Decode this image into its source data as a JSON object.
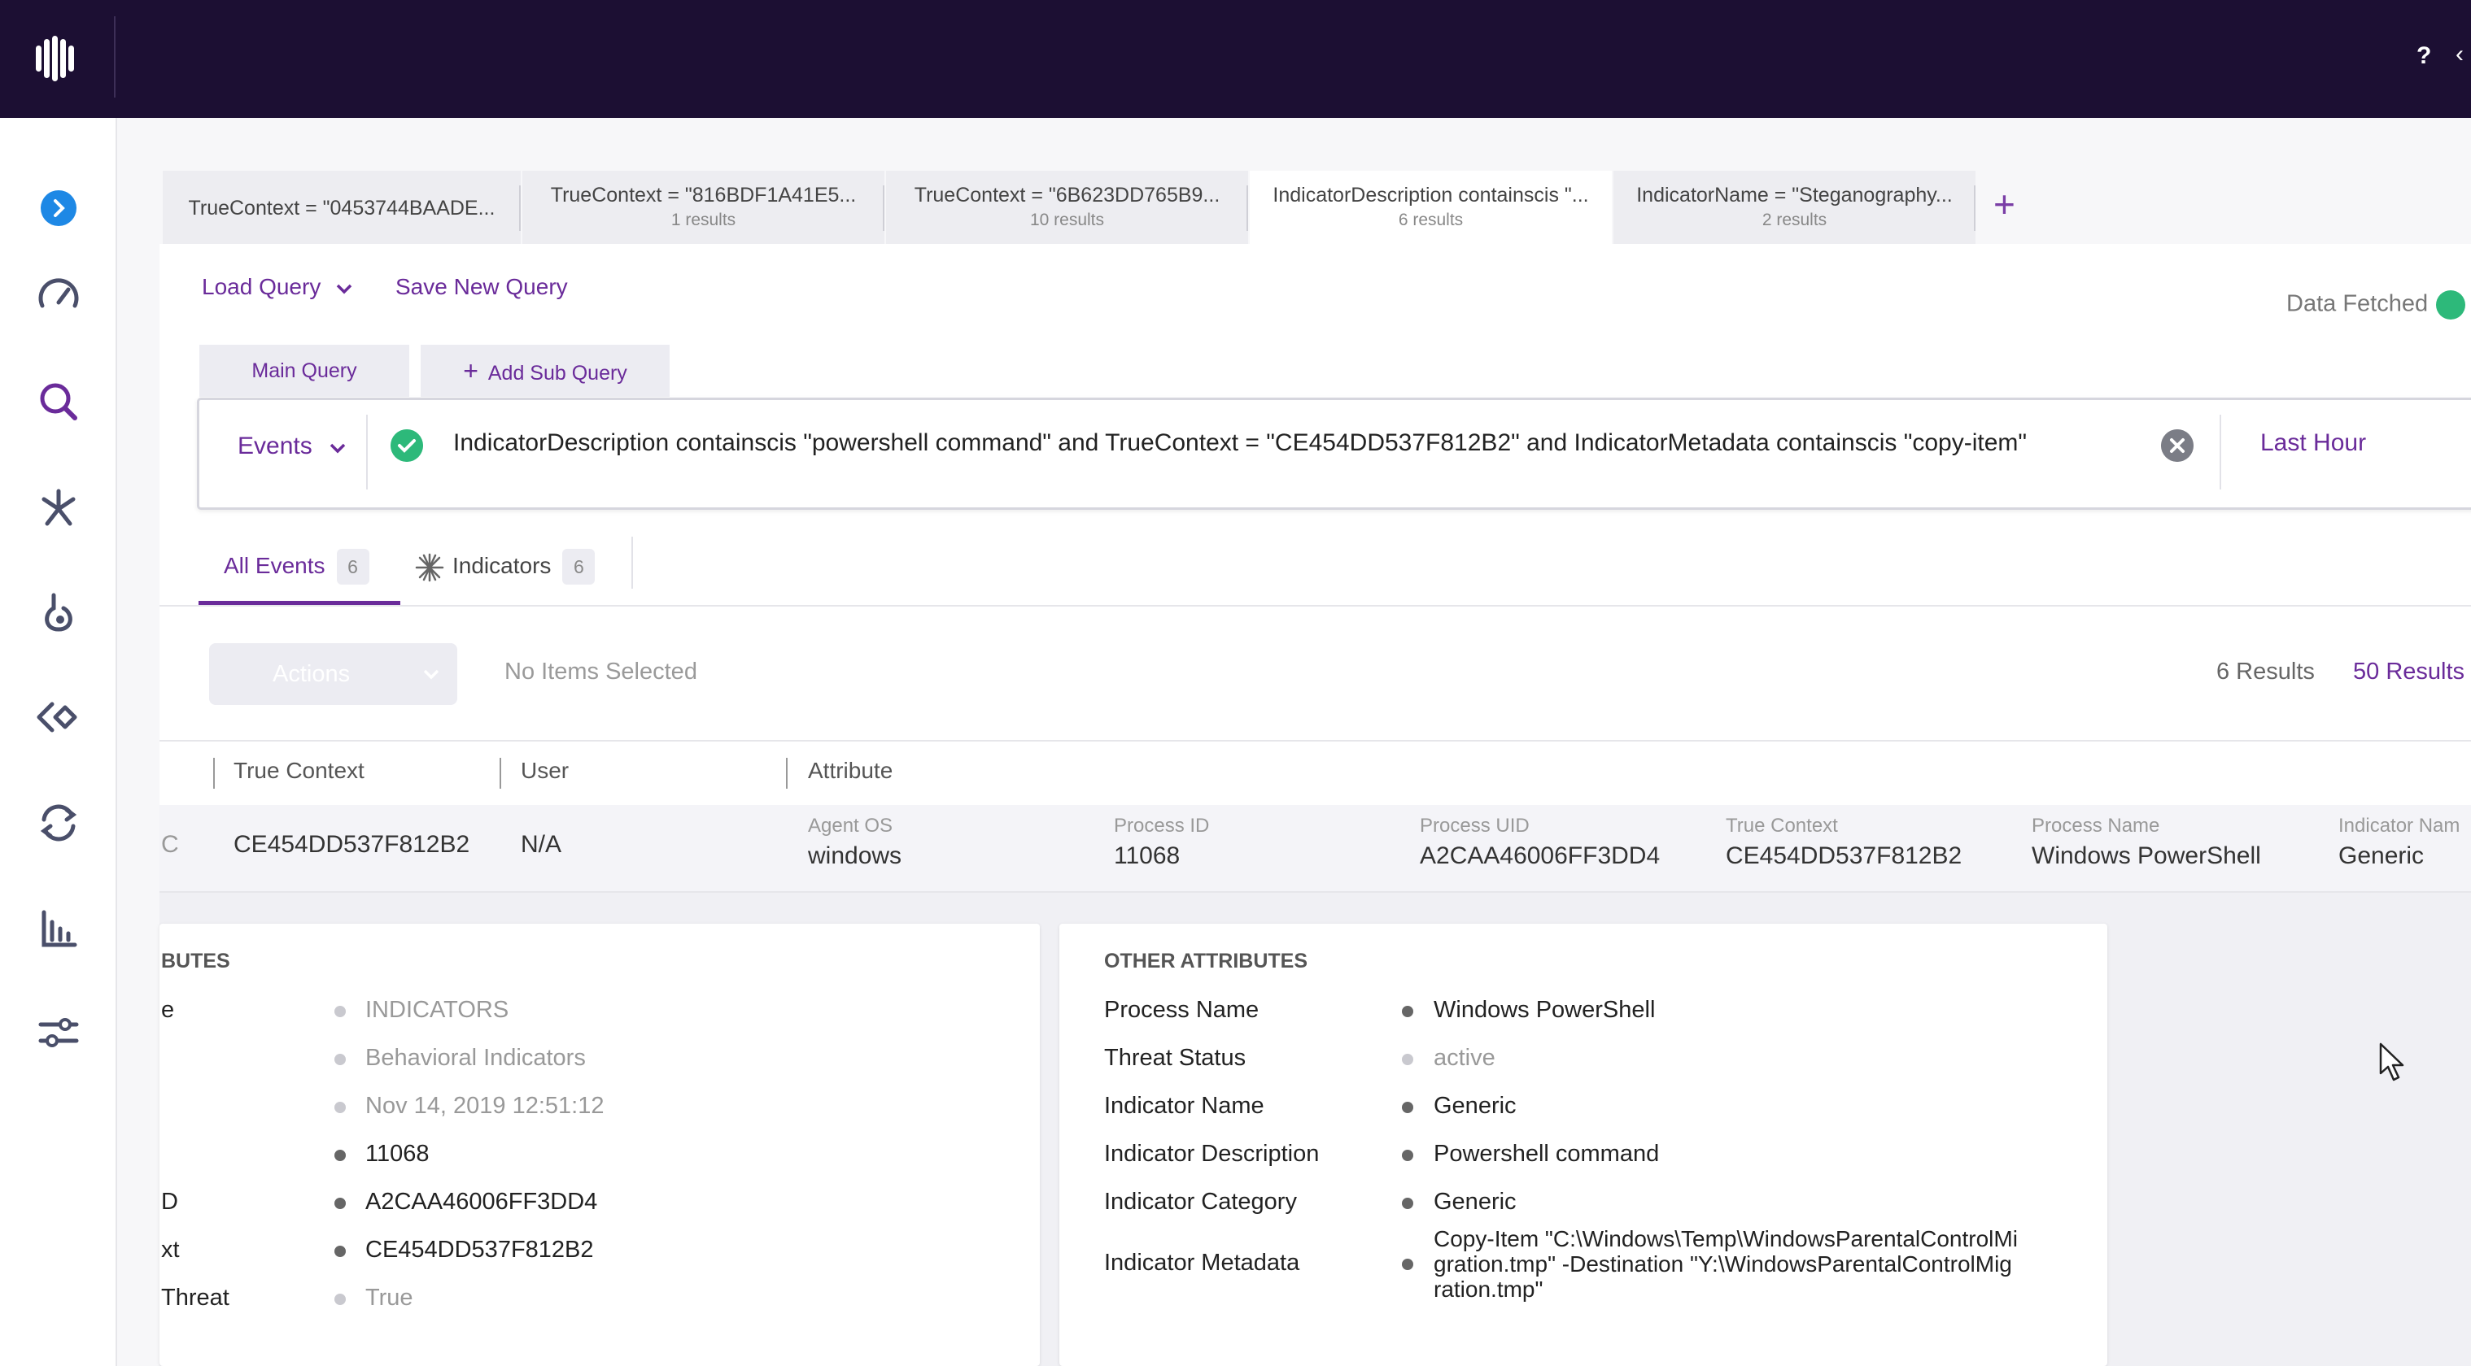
{
  "topbar": {
    "help": "?",
    "chevron": "‹"
  },
  "rail": {
    "icons": [
      "expand-icon",
      "dashboard-icon",
      "search-icon",
      "asterisk-icon",
      "flask-icon",
      "diamond-icon",
      "sync-icon",
      "bar-chart-icon",
      "sliders-icon"
    ]
  },
  "query_tabs": [
    {
      "title": "TrueContext = \"0453744BAADE...",
      "subtitle": ""
    },
    {
      "title": "TrueContext = \"816BDF1A41E5...",
      "subtitle": "1 results"
    },
    {
      "title": "TrueContext = \"6B623DD765B9...",
      "subtitle": "10 results"
    },
    {
      "title": "IndicatorDescription containscis \"...",
      "subtitle": "6 results"
    },
    {
      "title": "IndicatorName = \"Steganography...",
      "subtitle": "2 results"
    }
  ],
  "add_tab": "+",
  "toolbar": {
    "load_query": "Load Query",
    "save_query": "Save New Query",
    "status": "Data Fetched"
  },
  "subtabs": {
    "main": "Main Query",
    "add_sub": "Add Sub Query"
  },
  "query": {
    "source": "Events",
    "text": "IndicatorDescription containscis \"powershell command\" and TrueContext = \"CE454DD537F812B2\" and IndicatorMetadata containscis \"copy-item\"",
    "time_range": "Last Hour"
  },
  "result_tabs": {
    "all_events": "All Events",
    "all_events_count": "6",
    "indicators": "Indicators",
    "indicators_count": "6"
  },
  "actions_bar": {
    "actions": "Actions",
    "selection": "No Items Selected",
    "results": "6 Results",
    "per_page": "50 Results"
  },
  "columns": [
    "True Context",
    "User",
    "Attribute"
  ],
  "row": {
    "cut": "C",
    "true_context": "CE454DD537F812B2",
    "user": "N/A",
    "attributes": [
      {
        "k": "Agent OS",
        "v": "windows"
      },
      {
        "k": "Process ID",
        "v": "11068"
      },
      {
        "k": "Process UID",
        "v": "A2CAA46006FF3DD4"
      },
      {
        "k": "True Context",
        "v": "CE454DD537F812B2"
      },
      {
        "k": "Process Name",
        "v": "Windows PowerShell"
      },
      {
        "k": "Indicator Nam",
        "v": "Generic"
      }
    ]
  },
  "left_card": {
    "title": "BUTES",
    "rows": [
      {
        "k": "e",
        "v": "INDICATORS",
        "muted": true
      },
      {
        "k": "",
        "v": "Behavioral Indicators",
        "muted": true
      },
      {
        "k": "",
        "v": "Nov 14, 2019 12:51:12",
        "muted": true
      },
      {
        "k": "",
        "v": "11068",
        "muted": false
      },
      {
        "k": "D",
        "v": "A2CAA46006FF3DD4",
        "muted": false
      },
      {
        "k": "xt",
        "v": "CE454DD537F812B2",
        "muted": false
      },
      {
        "k": "Threat",
        "v": "True",
        "muted": true
      }
    ]
  },
  "right_card": {
    "title": "OTHER ATTRIBUTES",
    "rows": [
      {
        "k": "Process Name",
        "v": "Windows PowerShell",
        "muted": false
      },
      {
        "k": "Threat Status",
        "v": "active",
        "muted": true
      },
      {
        "k": "Indicator Name",
        "v": "Generic",
        "muted": false
      },
      {
        "k": "Indicator Description",
        "v": "Powershell command",
        "muted": false
      },
      {
        "k": "Indicator Category",
        "v": "Generic",
        "muted": false
      }
    ],
    "metadata_label": "Indicator Metadata",
    "metadata_value": "Copy-Item \"C:\\Windows\\Temp\\WindowsParentalControlMigration.tmp\" -Destination \"Y:\\WindowsParentalControlMigration.tmp\""
  },
  "colors": {
    "accent": "#6a2b9a",
    "topbar": "#1c0f33",
    "success": "#2db97a",
    "rail_icon": "#4a4f6a",
    "rail_active": "#1e88e5"
  }
}
